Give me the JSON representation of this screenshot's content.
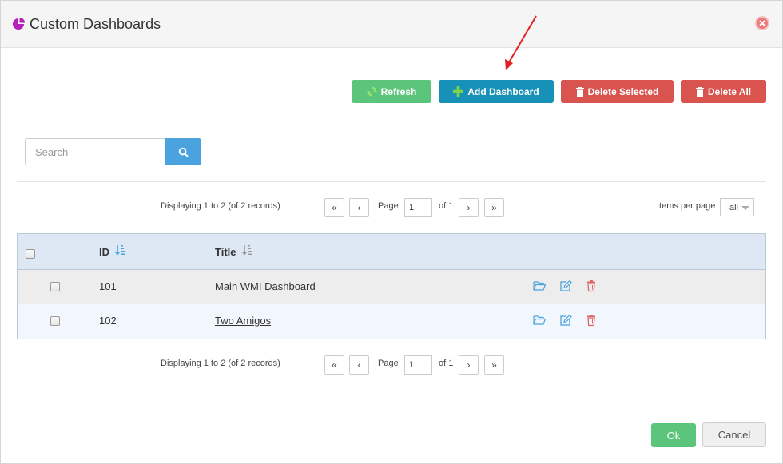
{
  "header": {
    "title": "Custom Dashboards",
    "logo_icon": "pie-chart-icon",
    "close_icon": "close-circle-icon"
  },
  "toolbar": {
    "refresh_label": "Refresh",
    "add_label": "Add Dashboard",
    "delete_selected_label": "Delete Selected",
    "delete_all_label": "Delete All"
  },
  "search": {
    "placeholder": "Search",
    "value": ""
  },
  "pager_top": {
    "info": "Displaying 1 to 2 (of 2 records)",
    "first": "«",
    "prev": "‹",
    "page_label": "Page",
    "page_value": "1",
    "of_label": "of 1",
    "next": "›",
    "last": "»"
  },
  "pager_bottom": {
    "info": "Displaying 1 to 2 (of 2 records)",
    "first": "«",
    "prev": "‹",
    "page_label": "Page",
    "page_value": "1",
    "of_label": "of 1",
    "next": "›",
    "last": "»"
  },
  "items_per_page": {
    "label": "Items per page",
    "value": "all"
  },
  "table": {
    "columns": {
      "id": "ID",
      "title": "Title"
    },
    "rows": [
      {
        "id": "101",
        "title": "Main WMI Dashboard"
      },
      {
        "id": "102",
        "title": "Two Amigos"
      }
    ]
  },
  "footer": {
    "ok_label": "Ok",
    "cancel_label": "Cancel"
  },
  "colors": {
    "green": "#5cc57c",
    "teal": "#1791b7",
    "red": "#d9534f",
    "blue": "#4aa3df"
  }
}
